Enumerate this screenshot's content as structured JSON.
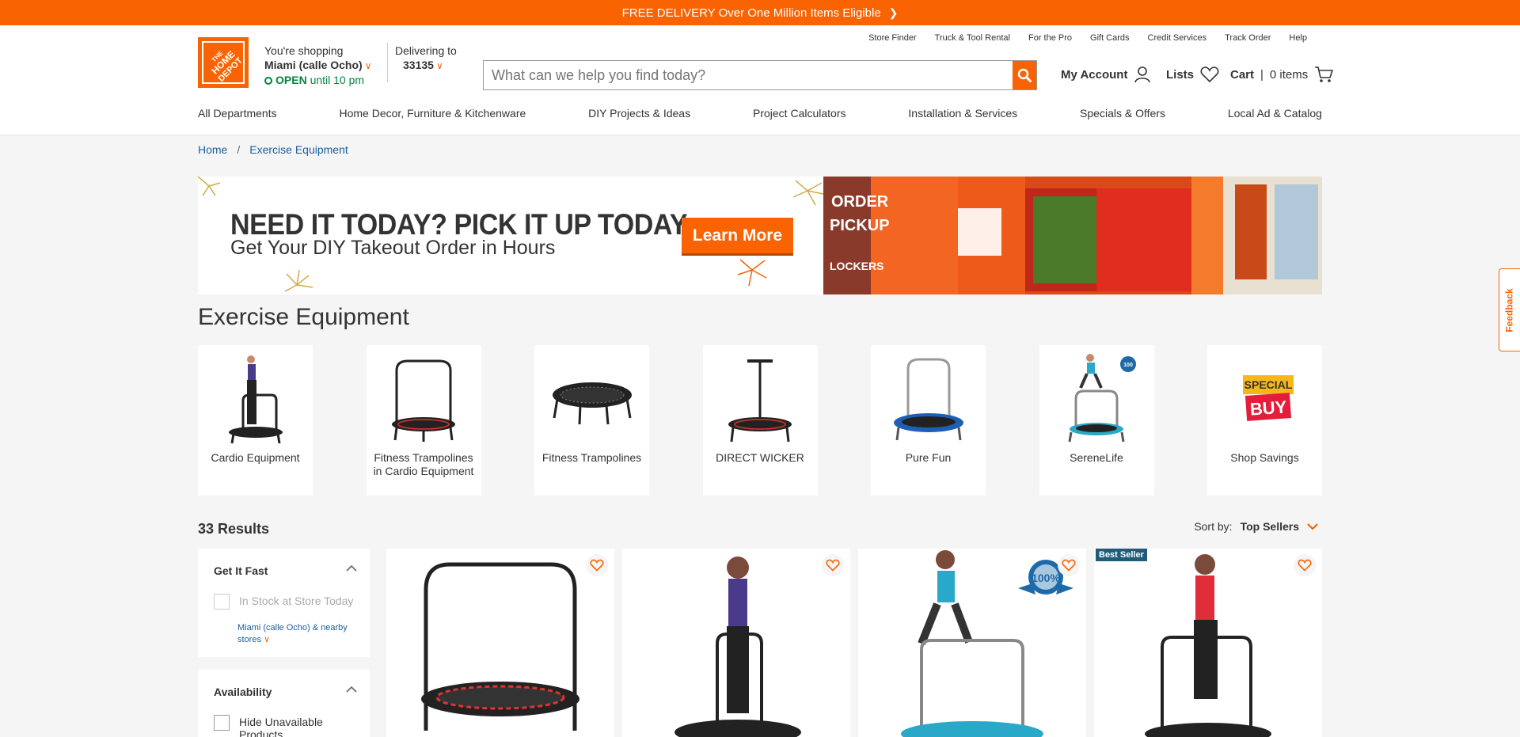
{
  "promo": {
    "text": "FREE DELIVERY Over One Million Items Eligible"
  },
  "header": {
    "store_prefix": "You're shopping",
    "store_name": "Miami (calle Ocho)",
    "open_label": "OPEN",
    "open_hours": "until 10 pm",
    "deliver_label": "Delivering to",
    "zip": "33135",
    "utility_links": [
      "Store Finder",
      "Truck & Tool Rental",
      "For the Pro",
      "Gift Cards",
      "Credit Services",
      "Track Order",
      "Help"
    ],
    "search_placeholder": "What can we help you find today?",
    "account_label": "My Account",
    "lists_label": "Lists",
    "cart_label": "Cart",
    "cart_count": "0 items"
  },
  "nav": [
    "All Departments",
    "Home Decor, Furniture & Kitchenware",
    "DIY Projects & Ideas",
    "Project Calculators",
    "Installation & Services",
    "Specials & Offers",
    "Local Ad & Catalog"
  ],
  "breadcrumb": [
    "Home",
    "Exercise Equipment"
  ],
  "banner": {
    "headline": "NEED IT TODAY? PICK IT UP TODAY.",
    "subline": "Get Your DIY Takeout Order in Hours",
    "cta": "Learn More",
    "photo_text_1": "ORDER",
    "photo_text_2": "PICKUP",
    "photo_text_3": "LOCKERS"
  },
  "category_title": "Exercise Equipment",
  "categories": [
    {
      "label": "Cardio Equipment"
    },
    {
      "label": "Fitness Trampolines in Cardio Equipment"
    },
    {
      "label": "Fitness Trampolines"
    },
    {
      "label": "DIRECT WICKER"
    },
    {
      "label": "Pure Fun"
    },
    {
      "label": "SereneLife"
    },
    {
      "label": "Shop Savings",
      "art_top": "SPECIAL",
      "art_bottom": "BUY"
    }
  ],
  "results_count": "33 Results",
  "sort": {
    "label": "Sort by:",
    "value": "Top Sellers"
  },
  "filters": {
    "get_it_fast": {
      "title": "Get It Fast",
      "option": "In Stock at Store Today",
      "store_link": "Miami (calle Ocho) & nearby stores"
    },
    "availability": {
      "title": "Availability",
      "option": "Hide Unavailable Products"
    }
  },
  "products": [
    {
      "badge": ""
    },
    {
      "badge": ""
    },
    {
      "badge": "",
      "seal": "100%"
    },
    {
      "badge": "Best Seller"
    }
  ],
  "feedback_label": "Feedback",
  "colors": {
    "brand_orange": "#f96302",
    "link_blue": "#1a5f9c",
    "open_green": "#00853f",
    "badge_blue": "#205c79"
  }
}
